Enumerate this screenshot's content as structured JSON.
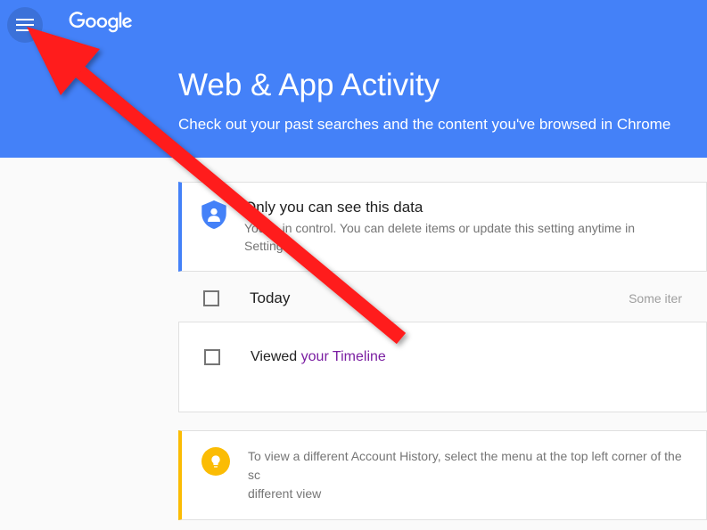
{
  "header": {
    "logo": "Google",
    "title": "Web & App Activity",
    "subtitle": "Check out your past searches and the content you've browsed in Chrome"
  },
  "privacy": {
    "title": "Only you can see this data",
    "desc": "You're in control. You can delete items or update this setting anytime in Settings."
  },
  "section": {
    "title": "Today",
    "right": "Some iter"
  },
  "activity": {
    "prefix": "Viewed ",
    "link": "your Timeline"
  },
  "tip": {
    "line1": "To view a different Account History, select the menu at the top left corner of the sc",
    "line2": "different view"
  }
}
